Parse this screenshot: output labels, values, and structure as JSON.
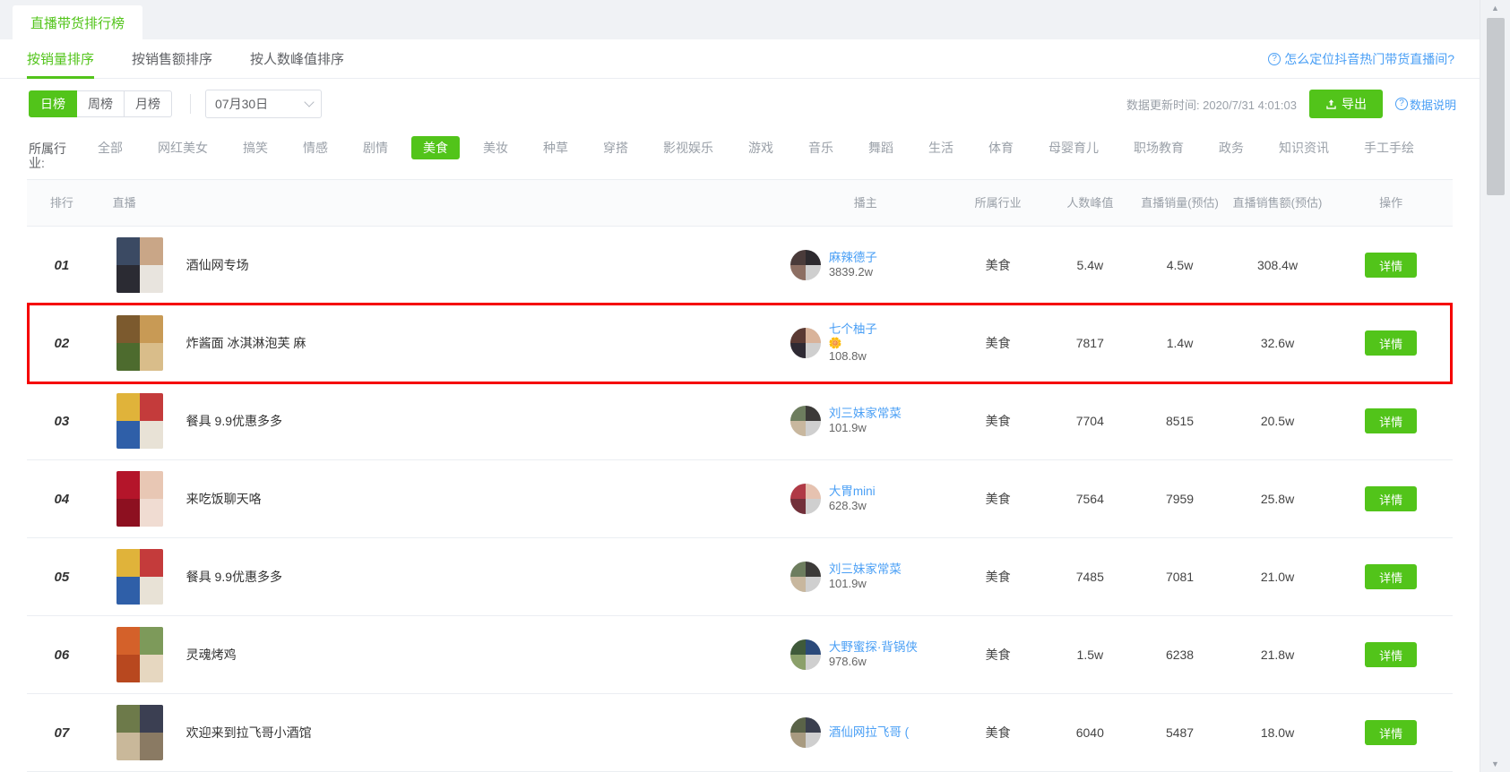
{
  "window": {
    "tab_label": "直播带货排行榜"
  },
  "sort_tabs": [
    {
      "label": "按销量排序",
      "active": true
    },
    {
      "label": "按销售额排序",
      "active": false
    },
    {
      "label": "按人数峰值排序",
      "active": false
    }
  ],
  "help_link": {
    "icon": "question-circle-icon",
    "label": "怎么定位抖音热门带货直播间?"
  },
  "filters": {
    "periods": [
      {
        "label": "日榜",
        "active": true
      },
      {
        "label": "周榜",
        "active": false
      },
      {
        "label": "月榜",
        "active": false
      }
    ],
    "date_value": "07月30日",
    "date_caret_icon": "chevron-down-icon",
    "update_time": "数据更新时间: 2020/7/31 4:01:03",
    "export_label": "导出",
    "export_icon": "upload-icon",
    "data_note_label": "数据说明",
    "data_note_icon": "question-circle-icon"
  },
  "industry": {
    "label": "所属行业:",
    "items": [
      {
        "label": "全部",
        "active": false
      },
      {
        "label": "网红美女",
        "active": false
      },
      {
        "label": "搞笑",
        "active": false
      },
      {
        "label": "情感",
        "active": false
      },
      {
        "label": "剧情",
        "active": false
      },
      {
        "label": "美食",
        "active": true
      },
      {
        "label": "美妆",
        "active": false
      },
      {
        "label": "种草",
        "active": false
      },
      {
        "label": "穿搭",
        "active": false
      },
      {
        "label": "影视娱乐",
        "active": false
      },
      {
        "label": "游戏",
        "active": false
      },
      {
        "label": "音乐",
        "active": false
      },
      {
        "label": "舞蹈",
        "active": false
      },
      {
        "label": "生活",
        "active": false
      },
      {
        "label": "体育",
        "active": false
      },
      {
        "label": "母婴育儿",
        "active": false
      },
      {
        "label": "职场教育",
        "active": false
      },
      {
        "label": "政务",
        "active": false
      },
      {
        "label": "知识资讯",
        "active": false
      },
      {
        "label": "手工手绘",
        "active": false
      }
    ]
  },
  "table": {
    "columns": [
      "排行",
      "直播",
      "播主",
      "所属行业",
      "人数峰值",
      "直播销量(预估)",
      "直播销售额(预估)",
      "操作"
    ],
    "action_label": "详情",
    "rows": [
      {
        "rank": "01",
        "live_title": "酒仙网专场",
        "anchor_name": "麻辣德子",
        "anchor_badge": "",
        "anchor_fans": "3839.2w",
        "industry": "美食",
        "peak": "5.4w",
        "volume": "4.5w",
        "amount": "308.4w",
        "highlighted": false,
        "thumb_colors": [
          "#3b4a63",
          "#c9a687",
          "#2b2b33",
          "#e8e4de"
        ],
        "avatar_colors": [
          "#4a3b3a",
          "#2d2a2e",
          "#8d6f63"
        ]
      },
      {
        "rank": "02",
        "live_title": "炸酱面 冰淇淋泡芙 麻",
        "anchor_name": "七个柚子",
        "anchor_badge": "🌼",
        "anchor_fans": "108.8w",
        "industry": "美食",
        "peak": "7817",
        "volume": "1.4w",
        "amount": "32.6w",
        "highlighted": true,
        "thumb_colors": [
          "#7c5a2e",
          "#c89a55",
          "#4d6b2e",
          "#d9bd8a"
        ],
        "avatar_colors": [
          "#5b3a33",
          "#d9b39a",
          "#2e2a33"
        ]
      },
      {
        "rank": "03",
        "live_title": "餐具 9.9优惠多多",
        "anchor_name": "刘三妹家常菜",
        "anchor_badge": "",
        "anchor_fans": "101.9w",
        "industry": "美食",
        "peak": "7704",
        "volume": "8515",
        "amount": "20.5w",
        "highlighted": false,
        "thumb_colors": [
          "#e0b33a",
          "#c43b3b",
          "#2f5fa8",
          "#e8e2d6"
        ],
        "avatar_colors": [
          "#6d7d5e",
          "#3c3a38",
          "#c8b79e"
        ]
      },
      {
        "rank": "04",
        "live_title": "来吃饭聊天咯",
        "anchor_name": "大胃mini",
        "anchor_badge": "",
        "anchor_fans": "628.3w",
        "industry": "美食",
        "peak": "7564",
        "volume": "7959",
        "amount": "25.8w",
        "highlighted": false,
        "thumb_colors": [
          "#b4152a",
          "#e8c7b4",
          "#8d1020",
          "#f0dcd2"
        ],
        "avatar_colors": [
          "#b03a46",
          "#e6c2b0",
          "#72303a"
        ]
      },
      {
        "rank": "05",
        "live_title": "餐具 9.9优惠多多",
        "anchor_name": "刘三妹家常菜",
        "anchor_badge": "",
        "anchor_fans": "101.9w",
        "industry": "美食",
        "peak": "7485",
        "volume": "7081",
        "amount": "21.0w",
        "highlighted": false,
        "thumb_colors": [
          "#e0b33a",
          "#c43b3b",
          "#2f5fa8",
          "#e8e2d6"
        ],
        "avatar_colors": [
          "#6d7d5e",
          "#3c3a38",
          "#c8b79e"
        ]
      },
      {
        "rank": "06",
        "live_title": "灵魂烤鸡",
        "anchor_name": "大野蜜探·背锅侠",
        "anchor_badge": "",
        "anchor_fans": "978.6w",
        "industry": "美食",
        "peak": "1.5w",
        "volume": "6238",
        "amount": "21.8w",
        "highlighted": false,
        "thumb_colors": [
          "#d4612a",
          "#7d9a5a",
          "#b8481f",
          "#e6d7c0"
        ],
        "avatar_colors": [
          "#3f5a3a",
          "#2b4a7a",
          "#8ba06a"
        ]
      },
      {
        "rank": "07",
        "live_title": "欢迎来到拉飞哥小酒馆",
        "anchor_name": "酒仙网拉飞哥 (",
        "anchor_badge": "",
        "anchor_fans": "",
        "industry": "美食",
        "peak": "6040",
        "volume": "5487",
        "amount": "18.0w",
        "highlighted": false,
        "thumb_colors": [
          "#6d7a4a",
          "#3b3f52",
          "#c9b89a",
          "#8a7a63"
        ],
        "avatar_colors": [
          "#5a6348",
          "#3a3f4e",
          "#a89a80"
        ]
      }
    ]
  },
  "scrollbar": {
    "up_icon": "caret-up-icon",
    "down_icon": "caret-down-icon"
  },
  "colors": {
    "brand_green": "#52c41a",
    "link_blue": "#4a9ff5",
    "highlight_red": "#f50000"
  }
}
